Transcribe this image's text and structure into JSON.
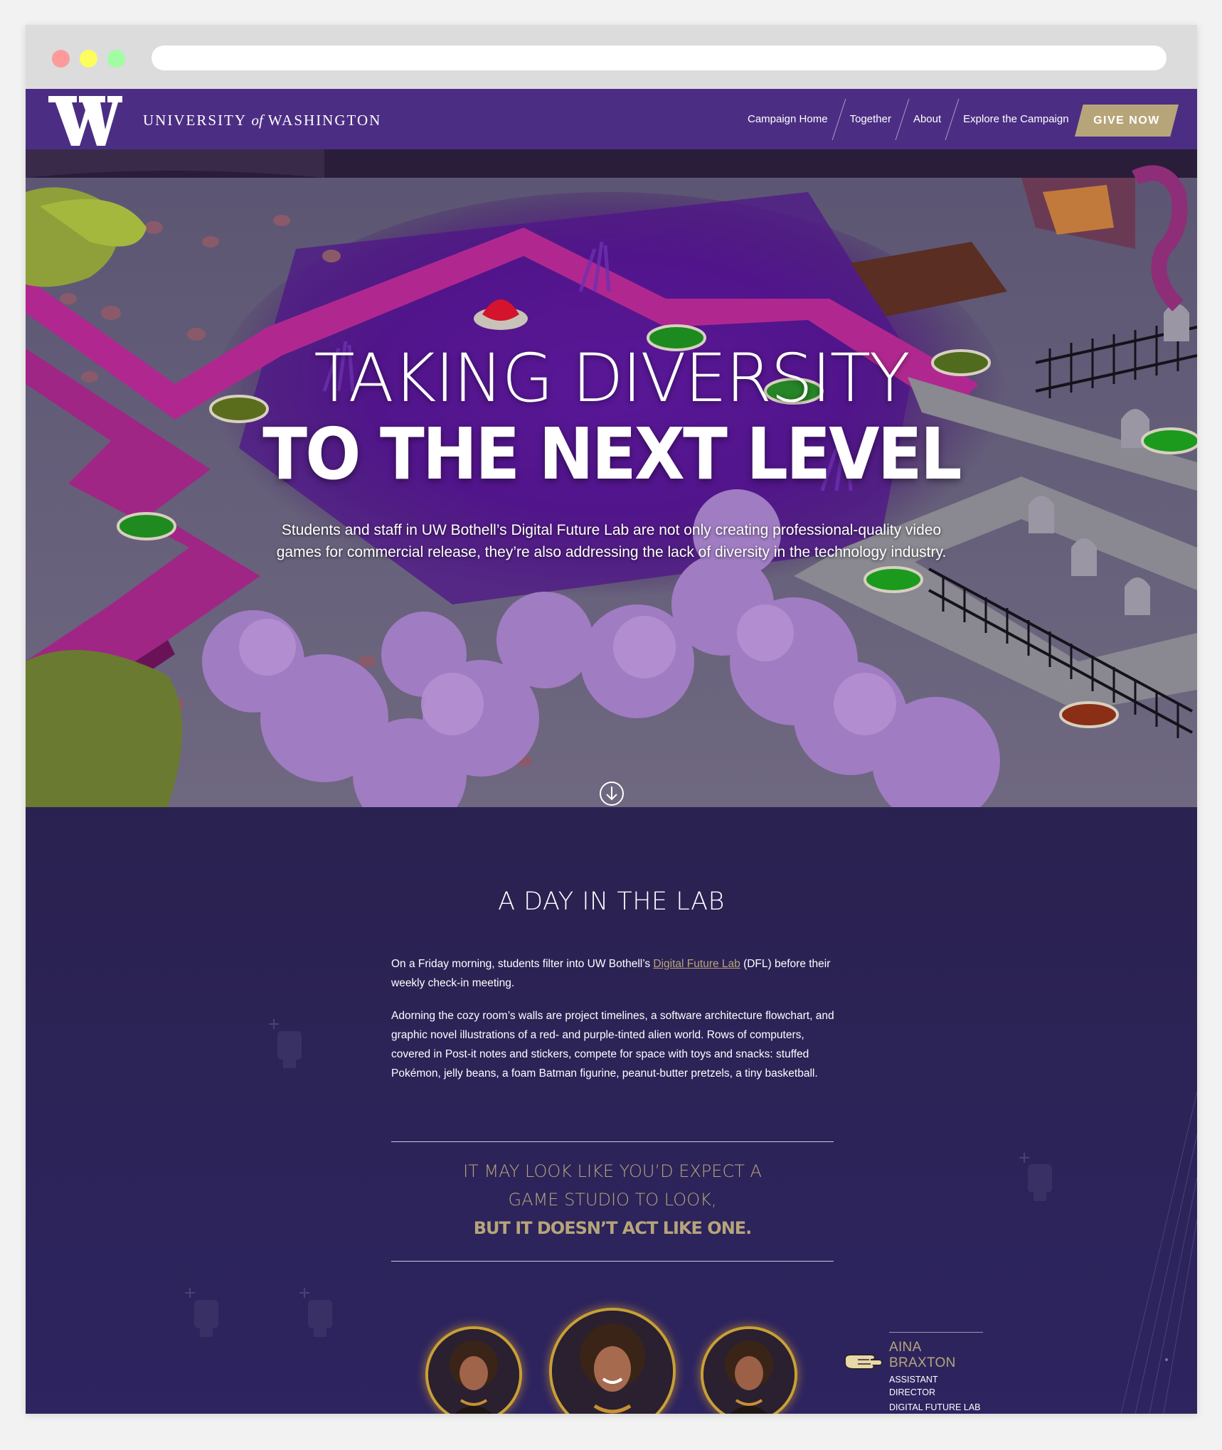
{
  "browser": {
    "url": ""
  },
  "header": {
    "logo_letter": "W",
    "logo_text_before": "UNIVERSITY",
    "logo_text_of": "of",
    "logo_text_after": "WASHINGTON",
    "nav": [
      {
        "label": "Campaign Home"
      },
      {
        "label": "Together"
      },
      {
        "label": "About"
      },
      {
        "label": "Explore the Campaign"
      }
    ],
    "give_label": "GIVE NOW"
  },
  "hero": {
    "title_line1": "TAKING DIVERSITY",
    "title_line2": "TO THE NEXT LEVEL",
    "subtitle": "Students and staff in UW Bothell’s Digital Future Lab are not only creating professional-quality video games for commercial release, they’re also addressing the lack of diversity in the technology industry.",
    "scroll_icon": "arrow-down-circle-icon"
  },
  "article": {
    "section_title": "A DAY IN THE LAB",
    "p1_before": "On a Friday morning, students filter into UW Bothell’s ",
    "p1_link": "Digital Future Lab",
    "p1_after": " (DFL) before their weekly check-in meeting.",
    "p2": "Adorning the cozy room’s walls are project timelines, a software architecture flowchart, and graphic novel illustrations of a red- and purple-tinted alien world. Rows of computers, covered in Post-it notes and stickers, compete for space with toys and snacks: stuffed Pokémon, jelly beans, a foam Batman figurine, peanut-butter pretzels, a tiny basketball.",
    "quote_line1": "IT MAY LOOK LIKE YOU’D EXPECT A",
    "quote_line2": "GAME STUDIO TO LOOK,",
    "quote_line3": "BUT IT DOESN’T ACT LIKE ONE."
  },
  "profile": {
    "name": "AINA BRAXTON",
    "role_line1": "ASSISTANT DIRECTOR",
    "role_line2": "DIGITAL FUTURE LAB",
    "pointer_icon": "pointing-hand-icon"
  },
  "colors": {
    "purple": "#4b2e83",
    "gold": "#b7a57a",
    "content_bg": "#2c2356"
  }
}
